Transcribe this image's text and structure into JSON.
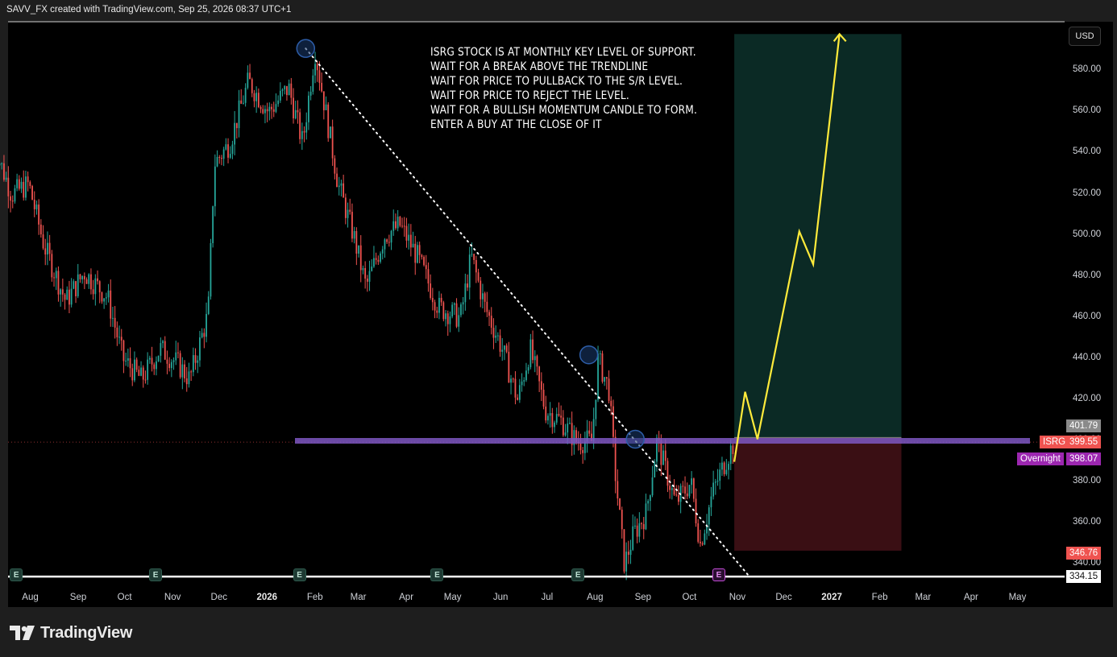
{
  "header": {
    "title": "SAVV_FX created with TradingView.com, Sep 25, 2026 08:37 UTC+1"
  },
  "currency_button": {
    "label": "USD"
  },
  "annotation": {
    "lines": [
      "ISRG STOCK IS AT MONTHLY KEY LEVEL OF SUPPORT.",
      "WAIT FOR A BREAK ABOVE THE TRENDLINE",
      "WAIT FOR PRICE TO PULLBACK TO THE S/R LEVEL.",
      "WAIT FOR PRICE TO REJECT THE LEVEL.",
      "WAIT FOR A BULLISH MOMENTUM CANDLE TO FORM.",
      "ENTER A BUY AT THE CLOSE OF IT"
    ]
  },
  "price_labels": {
    "position_top": "401.79",
    "symbol": "ISRG",
    "last_price": "399.55",
    "overnight_label": "Overnight",
    "overnight_price": "398.07",
    "stop_loss": "346.76",
    "low_line": "334.15"
  },
  "logo": {
    "text": "TradingView",
    "icon": "tradingview-logo-icon"
  },
  "colors": {
    "up": "#26a69a",
    "down": "#ef5350",
    "support": "#7e57c2",
    "target_zone": "#0b2a25",
    "stop_zone": "#3a0f14",
    "projection": "#ffeb3b",
    "overnight": "#9c27b0"
  },
  "chart_data": {
    "type": "candlestick",
    "symbol": "ISRG",
    "x_ticks": [
      "Aug",
      "Sep",
      "Oct",
      "Nov",
      "Dec",
      "2026",
      "Feb",
      "Mar",
      "Apr",
      "May",
      "Jun",
      "Jul",
      "Aug",
      "Sep",
      "Oct",
      "Nov",
      "Dec",
      "2027",
      "Feb",
      "Mar",
      "Apr",
      "May"
    ],
    "y_ticks": [
      340,
      360,
      380,
      400,
      420,
      440,
      460,
      480,
      500,
      520,
      540,
      560,
      580
    ],
    "y_tick_labels": [
      "340.00",
      "360.00",
      "380.00",
      "400.00",
      "420.00",
      "440.00",
      "460.00",
      "480.00",
      "500.00",
      "520.00",
      "540.00",
      "560.00",
      "580.00"
    ],
    "ylim": [
      326,
      598
    ],
    "price_path": [
      [
        "2025-07-08",
        545
      ],
      [
        "2025-07-20",
        520
      ],
      [
        "2025-07-31",
        525
      ],
      [
        "2025-08-10",
        495
      ],
      [
        "2025-08-24",
        468
      ],
      [
        "2025-09-05",
        482
      ],
      [
        "2025-09-20",
        470
      ],
      [
        "2025-09-30",
        440
      ],
      [
        "2025-10-12",
        430
      ],
      [
        "2025-10-24",
        445
      ],
      [
        "2025-11-04",
        438
      ],
      [
        "2025-11-12",
        430
      ],
      [
        "2025-11-24",
        462
      ],
      [
        "2025-11-28",
        535
      ],
      [
        "2025-12-08",
        545
      ],
      [
        "2025-12-20",
        575
      ],
      [
        "2026-01-02",
        560
      ],
      [
        "2026-01-15",
        572
      ],
      [
        "2026-01-24",
        545
      ],
      [
        "2026-02-01",
        590
      ],
      [
        "2026-02-08",
        560
      ],
      [
        "2026-02-16",
        525
      ],
      [
        "2026-02-26",
        500
      ],
      [
        "2026-03-06",
        475
      ],
      [
        "2026-03-18",
        500
      ],
      [
        "2026-03-28",
        505
      ],
      [
        "2026-04-08",
        490
      ],
      [
        "2026-04-22",
        465
      ],
      [
        "2026-05-06",
        460
      ],
      [
        "2026-05-13",
        490
      ],
      [
        "2026-05-22",
        465
      ],
      [
        "2026-06-02",
        445
      ],
      [
        "2026-06-12",
        420
      ],
      [
        "2026-06-20",
        445
      ],
      [
        "2026-06-30",
        415
      ],
      [
        "2026-07-10",
        410
      ],
      [
        "2026-07-20",
        400
      ],
      [
        "2026-07-30",
        400
      ],
      [
        "2026-08-03",
        440
      ],
      [
        "2026-08-10",
        425
      ],
      [
        "2026-08-14",
        385
      ],
      [
        "2026-08-20",
        340
      ],
      [
        "2026-08-26",
        355
      ],
      [
        "2026-09-03",
        365
      ],
      [
        "2026-09-10",
        400
      ],
      [
        "2026-09-16",
        385
      ],
      [
        "2026-09-22",
        370
      ],
      [
        "2026-10-02",
        380
      ],
      [
        "2026-10-08",
        350
      ],
      [
        "2026-10-16",
        375
      ],
      [
        "2026-10-24",
        390
      ],
      [
        "2026-10-30",
        399.55
      ]
    ],
    "support_level": 400,
    "trendline": {
      "from": [
        "2026-01-26",
        591
      ],
      "to": [
        "2026-11-09",
        334
      ]
    },
    "trendline_touches": [
      [
        "2026-01-26",
        591
      ],
      [
        "2026-07-28",
        442
      ],
      [
        "2026-08-27",
        401
      ]
    ],
    "long_position": {
      "entry": 401.79,
      "stop": 346.76,
      "target": 598,
      "start": "2026-10-30",
      "end": "2027-02-15"
    },
    "projection_path": [
      [
        "2026-10-30",
        390
      ],
      [
        "2026-11-06",
        424
      ],
      [
        "2026-11-14",
        401
      ],
      [
        "2026-12-11",
        502
      ],
      [
        "2026-12-20",
        486
      ],
      [
        "2027-01-06",
        598
      ]
    ],
    "low_line": 334.15,
    "earnings_dates": [
      "2025-07-23",
      "2025-10-21",
      "2026-01-22",
      "2026-04-21",
      "2026-07-21",
      "2026-10-20"
    ],
    "upcoming_earnings": "2026-10-20"
  }
}
